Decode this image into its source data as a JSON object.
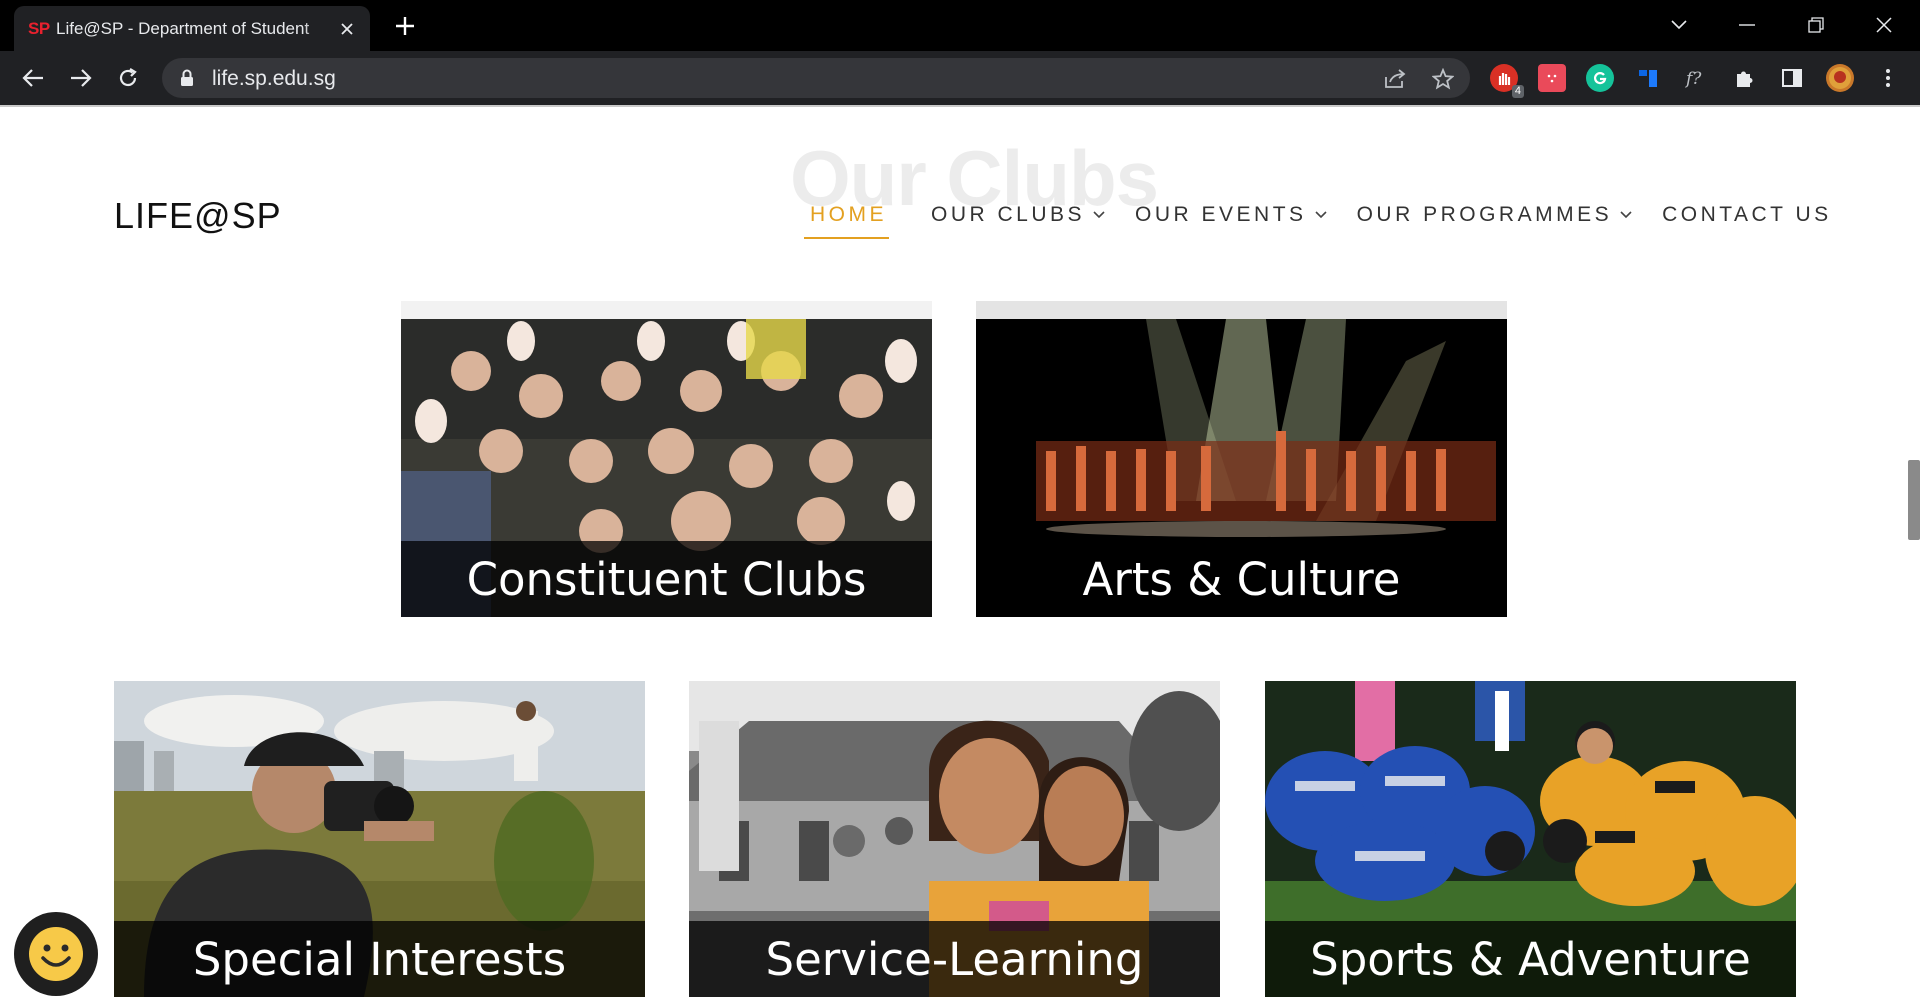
{
  "browser": {
    "tab": {
      "favicon_text": "SP",
      "title": "Life@SP - Department of Student"
    },
    "url": "life.sp.edu.sg",
    "extension_badge": "4"
  },
  "site": {
    "logo": "LIFE@SP",
    "background_heading": "Our Clubs",
    "nav": [
      {
        "label": "HOME",
        "active": true
      },
      {
        "label": "OUR CLUBS",
        "dropdown": true
      },
      {
        "label": "OUR EVENTS",
        "dropdown": true
      },
      {
        "label": "OUR PROGRAMMES",
        "dropdown": true
      },
      {
        "label": "CONTACT US"
      }
    ],
    "accent_color": "#e3a020"
  },
  "cards": [
    {
      "title": "Constituent Clubs"
    },
    {
      "title": "Arts & Culture"
    },
    {
      "title": "Special Interests"
    },
    {
      "title": "Service-Learning"
    },
    {
      "title": "Sports & Adventure"
    }
  ],
  "chat_widget": {
    "icon": "smiley-icon"
  }
}
